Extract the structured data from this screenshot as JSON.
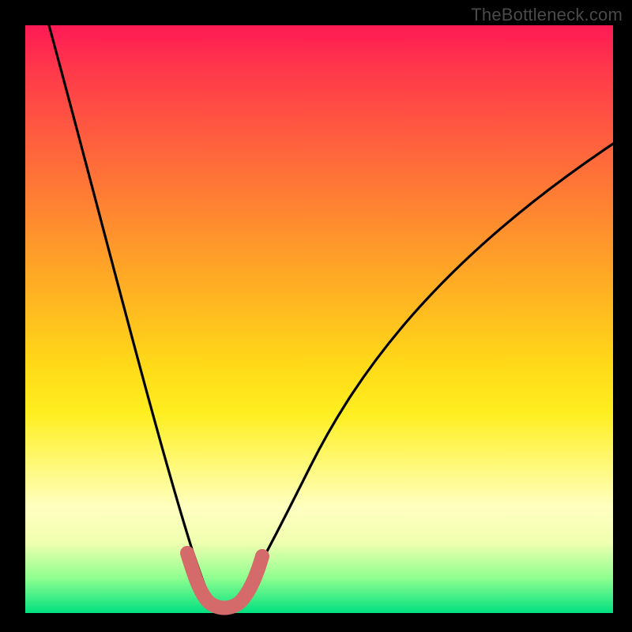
{
  "watermark": "TheBottleneck.com",
  "gradient_colors": {
    "top": "#ff1a55",
    "mid": "#ffda18",
    "bottom": "#00e080"
  },
  "chart_data": {
    "type": "line",
    "title": "",
    "xlabel": "",
    "ylabel": "",
    "xlim": [
      0,
      100
    ],
    "ylim": [
      0,
      100
    ],
    "series": [
      {
        "name": "bottleneck-curve",
        "x": [
          4,
          6,
          8,
          10,
          12,
          14,
          16,
          18,
          20,
          22,
          24,
          26,
          28,
          29,
          30,
          31,
          32,
          33,
          34,
          35,
          38,
          42,
          46,
          50,
          55,
          60,
          65,
          70,
          75,
          80,
          85,
          90,
          95,
          100
        ],
        "y": [
          100,
          92,
          84,
          76,
          68,
          60,
          52,
          44,
          36,
          28,
          20,
          13,
          7,
          4,
          2,
          1.2,
          1,
          1.2,
          2,
          3.5,
          8,
          14,
          20,
          26,
          33,
          40,
          47,
          53,
          58,
          63,
          68,
          72,
          76,
          79
        ]
      },
      {
        "name": "highlight-band",
        "x": [
          27,
          28,
          29,
          30,
          31,
          32,
          33,
          34,
          35,
          36
        ],
        "y": [
          10,
          6,
          3.5,
          2,
          1.5,
          1.5,
          2,
          3.5,
          6,
          9
        ]
      }
    ],
    "highlight_color": "#d46a6a",
    "curve_color": "#000000",
    "note": "Axes are unlabeled in source image; values are normalized 0-100 estimates read from pixel positions."
  }
}
